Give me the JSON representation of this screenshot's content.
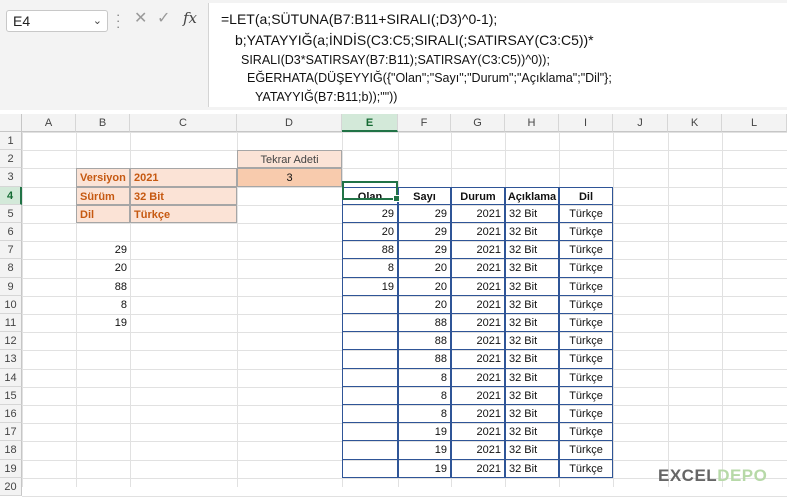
{
  "name_box": {
    "value": "E4"
  },
  "formula_bar": {
    "fx_label": "fx",
    "lines": [
      "=LET(a;SÜTUNA(B7:B11+SIRALI(;D3)^0-1);",
      "b;YATAYYIĞ(a;İNDİS(C3:C5;SIRALI(;SATIRSAY(C3:C5))*",
      "SIRALI(D3*SATIRSAY(B7:B11);SATIRSAY(C3:C5))^0));",
      "EĞERHATA(DÜŞEYYIĞ({\"Olan\";\"Sayı\";\"Durum\";\"Açıklama\";\"Dil\"};",
      "YATAYYIĞ(B7:B11;b));\"\"))"
    ]
  },
  "columns": [
    "A",
    "B",
    "C",
    "D",
    "E",
    "F",
    "G",
    "H",
    "I",
    "J",
    "K",
    "L"
  ],
  "rows": [
    "1",
    "2",
    "3",
    "4",
    "5",
    "6",
    "7",
    "8",
    "9",
    "10",
    "11",
    "12",
    "13",
    "14",
    "15",
    "16",
    "17",
    "18",
    "19",
    "20"
  ],
  "info": [
    {
      "label": "Versiyon",
      "value": "2021"
    },
    {
      "label": "Sürüm",
      "value": "32 Bit"
    },
    {
      "label": "Dil",
      "value": "Türkçe"
    }
  ],
  "tekrar": {
    "header": "Tekrar Adeti",
    "value": "3"
  },
  "list_values": [
    "29",
    "20",
    "88",
    "8",
    "19"
  ],
  "result_table": {
    "headers": [
      "Olan",
      "Sayı",
      "Durum",
      "Açıklama",
      "Dil"
    ],
    "rows": [
      [
        "29",
        "29",
        "2021",
        "32 Bit",
        "Türkçe"
      ],
      [
        "20",
        "29",
        "2021",
        "32 Bit",
        "Türkçe"
      ],
      [
        "88",
        "29",
        "2021",
        "32 Bit",
        "Türkçe"
      ],
      [
        "8",
        "20",
        "2021",
        "32 Bit",
        "Türkçe"
      ],
      [
        "19",
        "20",
        "2021",
        "32 Bit",
        "Türkçe"
      ],
      [
        "",
        "20",
        "2021",
        "32 Bit",
        "Türkçe"
      ],
      [
        "",
        "88",
        "2021",
        "32 Bit",
        "Türkçe"
      ],
      [
        "",
        "88",
        "2021",
        "32 Bit",
        "Türkçe"
      ],
      [
        "",
        "88",
        "2021",
        "32 Bit",
        "Türkçe"
      ],
      [
        "",
        "8",
        "2021",
        "32 Bit",
        "Türkçe"
      ],
      [
        "",
        "8",
        "2021",
        "32 Bit",
        "Türkçe"
      ],
      [
        "",
        "8",
        "2021",
        "32 Bit",
        "Türkçe"
      ],
      [
        "",
        "19",
        "2021",
        "32 Bit",
        "Türkçe"
      ],
      [
        "",
        "19",
        "2021",
        "32 Bit",
        "Türkçe"
      ],
      [
        "",
        "19",
        "2021",
        "32 Bit",
        "Türkçe"
      ]
    ]
  },
  "logo": {
    "part1": "EXCEL",
    "part2": "DEPO"
  }
}
